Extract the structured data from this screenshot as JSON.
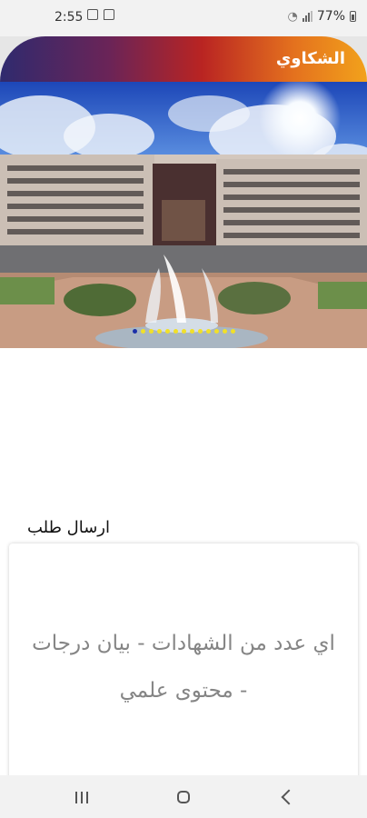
{
  "status_bar": {
    "time": "2:55",
    "battery": "77%"
  },
  "header": {
    "title": "الشكاوي"
  },
  "banner": {
    "slide_count": 13,
    "active_index": 0
  },
  "section": {
    "title": "ارسال طلب"
  },
  "request_card": {
    "line1": "اي عدد من الشهادات - بيان درجات",
    "line2": "- محتوى علمي"
  },
  "icons": {
    "status_left": [
      "image-icon",
      "message-icon"
    ],
    "status_right": [
      "wifi-icon",
      "signal-icon",
      "battery-icon"
    ],
    "nav": [
      "recent-apps-icon",
      "home-icon",
      "back-icon"
    ]
  },
  "colors": {
    "header_gradient": [
      "#2f2a6e",
      "#b92422",
      "#f2a21b"
    ],
    "dot_inactive": "#f1e028",
    "dot_active": "#1b2fa8",
    "card_text": "#858585"
  }
}
